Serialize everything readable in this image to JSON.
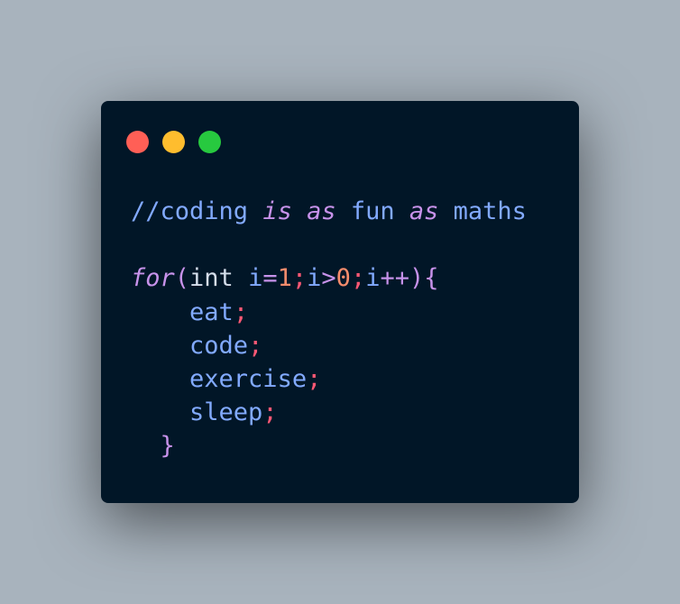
{
  "window": {
    "controls": [
      {
        "name": "close",
        "color": "#ff5f56"
      },
      {
        "name": "minimize",
        "color": "#ffbd2e"
      },
      {
        "name": "maximize",
        "color": "#27c93f"
      }
    ]
  },
  "colors": {
    "background": "#a8b3bd",
    "editor": "#011627",
    "keyword": "#c792ea",
    "identifier": "#82aaff",
    "number": "#f78c6c",
    "punctuation": "#ff5874",
    "plain": "#d6deeb"
  },
  "code": {
    "lines": [
      {
        "tokens": [
          {
            "text": "//coding ",
            "color": "#82aaff"
          },
          {
            "text": "is",
            "color": "#c792ea",
            "italic": true
          },
          {
            "text": " ",
            "color": "#82aaff"
          },
          {
            "text": "as",
            "color": "#c792ea",
            "italic": true
          },
          {
            "text": " fun ",
            "color": "#82aaff"
          },
          {
            "text": "as",
            "color": "#c792ea",
            "italic": true
          },
          {
            "text": " maths",
            "color": "#82aaff"
          }
        ]
      },
      {
        "tokens": []
      },
      {
        "tokens": [
          {
            "text": "for",
            "color": "#c792ea",
            "italic": true
          },
          {
            "text": "(",
            "color": "#c792ea"
          },
          {
            "text": "int ",
            "color": "#d6deeb"
          },
          {
            "text": "i",
            "color": "#82aaff"
          },
          {
            "text": "=",
            "color": "#c792ea"
          },
          {
            "text": "1",
            "color": "#f78c6c"
          },
          {
            "text": ";",
            "color": "#ff5874"
          },
          {
            "text": "i",
            "color": "#82aaff"
          },
          {
            "text": ">",
            "color": "#c792ea"
          },
          {
            "text": "0",
            "color": "#f78c6c"
          },
          {
            "text": ";",
            "color": "#ff5874"
          },
          {
            "text": "i",
            "color": "#82aaff"
          },
          {
            "text": "++",
            "color": "#c792ea"
          },
          {
            "text": "){",
            "color": "#c792ea"
          }
        ]
      },
      {
        "tokens": [
          {
            "text": "    ",
            "color": "#d6deeb"
          },
          {
            "text": "eat",
            "color": "#82aaff"
          },
          {
            "text": ";",
            "color": "#ff5874"
          }
        ]
      },
      {
        "tokens": [
          {
            "text": "    ",
            "color": "#d6deeb"
          },
          {
            "text": "code",
            "color": "#82aaff"
          },
          {
            "text": ";",
            "color": "#ff5874"
          }
        ]
      },
      {
        "tokens": [
          {
            "text": "    ",
            "color": "#d6deeb"
          },
          {
            "text": "exercise",
            "color": "#82aaff"
          },
          {
            "text": ";",
            "color": "#ff5874"
          }
        ]
      },
      {
        "tokens": [
          {
            "text": "    ",
            "color": "#d6deeb"
          },
          {
            "text": "sleep",
            "color": "#82aaff"
          },
          {
            "text": ";",
            "color": "#ff5874"
          }
        ]
      },
      {
        "tokens": [
          {
            "text": "  ",
            "color": "#d6deeb"
          },
          {
            "text": "}",
            "color": "#c792ea"
          }
        ]
      }
    ]
  }
}
